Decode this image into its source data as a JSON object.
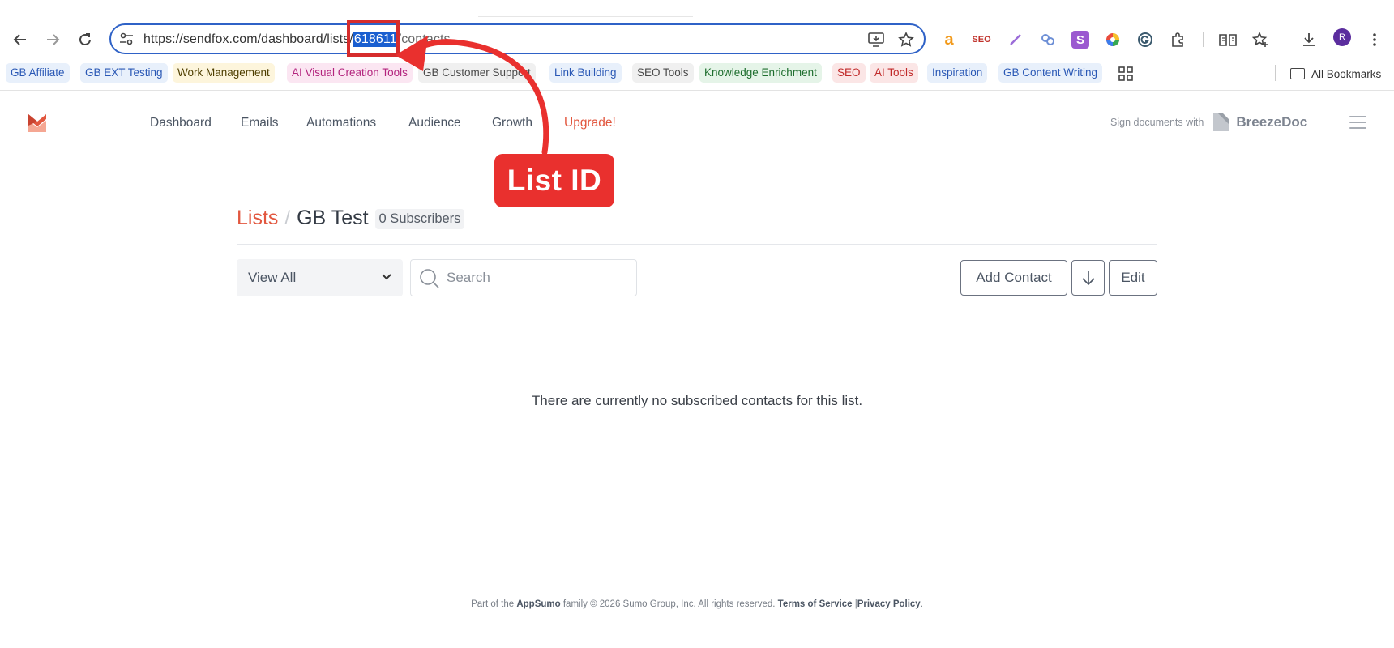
{
  "browser": {
    "url_prefix": "https://sendfox.com/dashboard/lists/",
    "url_selected": "618611",
    "url_suffix": "/contacts",
    "avatar_letter": "R",
    "extension_icons": [
      "amazon-icon",
      "seo-icon",
      "pen-icon",
      "link-icon",
      "s-extension-icon",
      "color-picker-icon",
      "grammarly-icon",
      "puzzle-icon"
    ],
    "bookmarks": [
      {
        "label": "GB Affiliate",
        "style": "blue"
      },
      {
        "label": "GB EXT Testing",
        "style": "blue"
      },
      {
        "label": "Work Management",
        "style": "yellow"
      },
      {
        "label": "AI Visual Creation Tools",
        "style": "pink"
      },
      {
        "label": "GB Customer Support",
        "style": "grey"
      },
      {
        "label": "Link Building",
        "style": "blue"
      },
      {
        "label": "SEO Tools",
        "style": "grey"
      },
      {
        "label": "Knowledge Enrichment",
        "style": "green"
      },
      {
        "label": "SEO",
        "style": "red"
      },
      {
        "label": "AI Tools",
        "style": "red"
      },
      {
        "label": "Inspiration",
        "style": "blue"
      },
      {
        "label": "GB Content Writing",
        "style": "blue"
      }
    ],
    "all_bookmarks": "All Bookmarks"
  },
  "app": {
    "nav": {
      "dashboard": "Dashboard",
      "emails": "Emails",
      "automations": "Automations",
      "audience": "Audience",
      "growth": "Growth",
      "upgrade": "Upgrade!"
    },
    "sign_documents": "Sign documents with",
    "breezedoc": "BreezeDoc",
    "accent_color": "#e2573f"
  },
  "page": {
    "breadcrumb_lists": "Lists",
    "breadcrumb_separator": "/",
    "list_name": "GB Test",
    "subscriber_count": "0 Subscribers",
    "filter_value": "View All",
    "search_placeholder": "Search",
    "add_contact": "Add Contact",
    "edit": "Edit",
    "empty_message": "There are currently no subscribed contacts for this list."
  },
  "footer": {
    "part_of": "Part of the",
    "appsumo": "AppSumo",
    "family": "family © 2026 Sumo Group, Inc. All rights reserved.",
    "terms": "Terms of Service",
    "divider": "|",
    "privacy": "Privacy Policy",
    "period": "."
  },
  "annotation": {
    "label": "List ID",
    "color": "#e9302e"
  }
}
